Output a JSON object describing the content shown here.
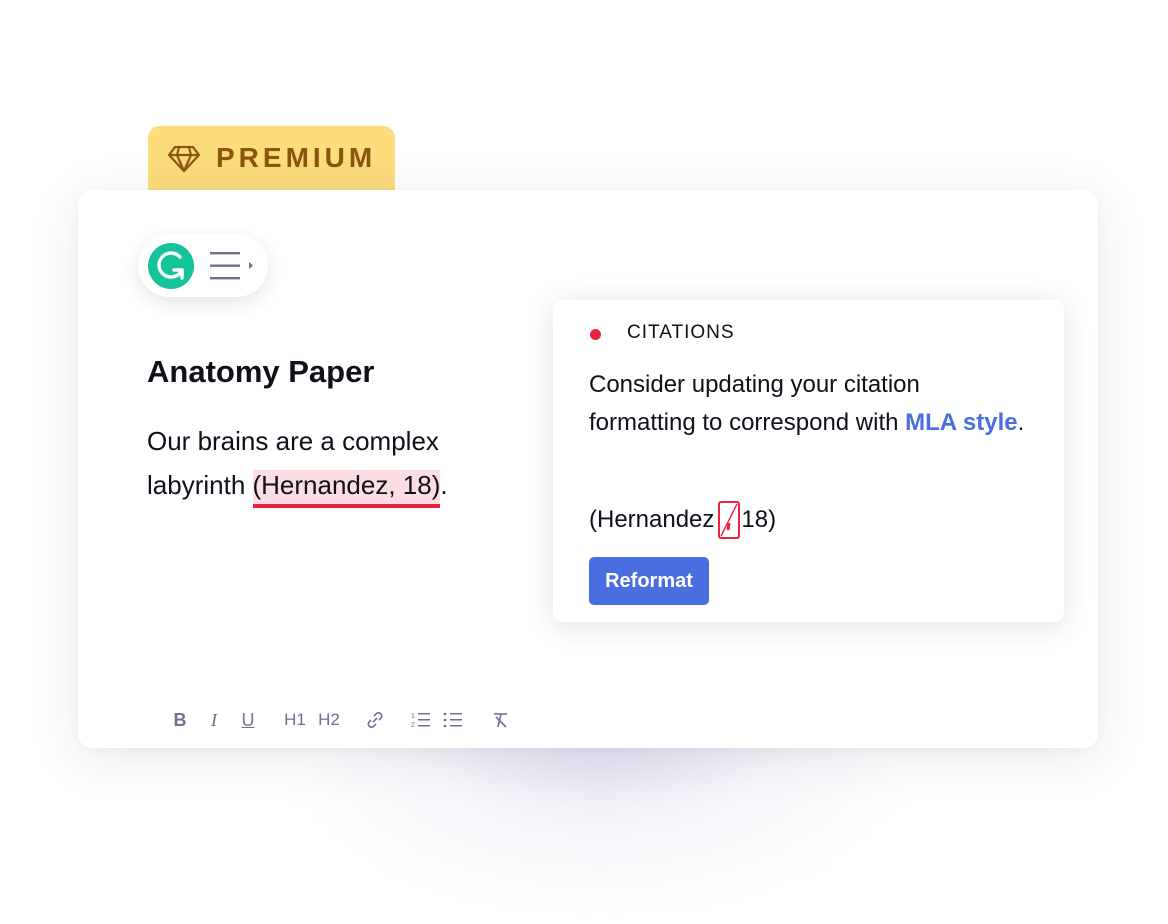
{
  "badge": {
    "label": "PREMIUM",
    "icon": "diamond-icon",
    "color": "#fddc7c",
    "text_color": "#8a560e"
  },
  "widget": {
    "logo_letter": "G",
    "logo_color": "#15c39a",
    "menu_icon": "menu-expand-icon"
  },
  "document": {
    "title": "Anatomy Paper",
    "body_before": "Our brains are a complex labyrinth ",
    "citation": "(Hernandez, 18)",
    "body_after": "."
  },
  "toolbar": {
    "items": [
      {
        "label": "B",
        "icon": "bold-icon"
      },
      {
        "label": "I",
        "icon": "italic-icon"
      },
      {
        "label": "U",
        "icon": "underline-icon"
      },
      {
        "label": "H1",
        "icon": "heading-1-icon"
      },
      {
        "label": "H2",
        "icon": "heading-2-icon"
      },
      {
        "label": "",
        "icon": "link-icon"
      },
      {
        "label": "",
        "icon": "numbered-list-icon"
      },
      {
        "label": "",
        "icon": "bulleted-list-icon"
      },
      {
        "label": "",
        "icon": "clear-format-icon"
      }
    ]
  },
  "suggestion": {
    "category": "CITATIONS",
    "status_color": "#e8223f",
    "message_before": "Consider updating your citation formatting to correspond with ",
    "message_link": "MLA style",
    "message_after": ".",
    "preview_before": "(Hernandez",
    "preview_removed": ",",
    "preview_after": "18)",
    "action_label": "Reformat",
    "accent_color": "#4a6ee0"
  }
}
